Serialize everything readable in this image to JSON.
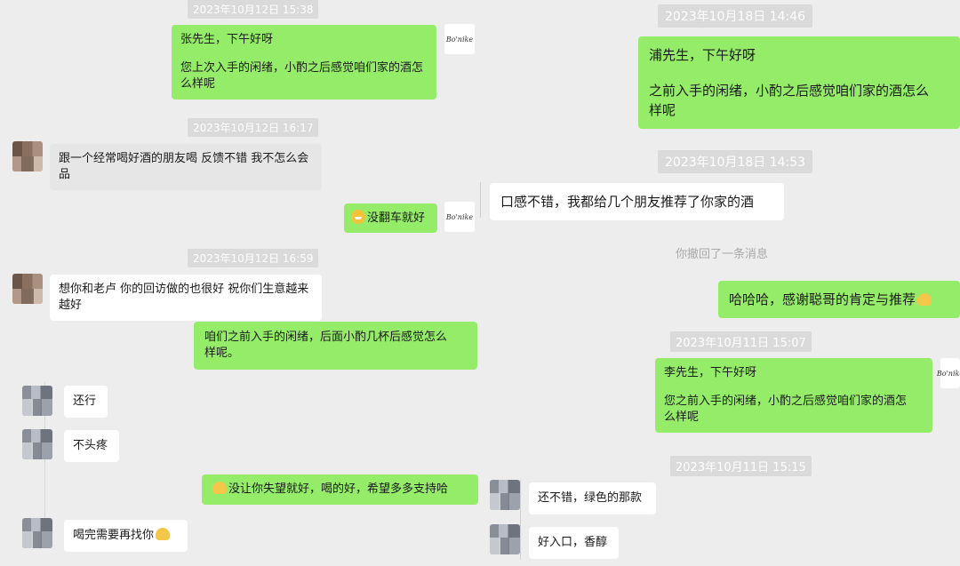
{
  "left": {
    "timestamps": [
      "2023年10月12日 15:38",
      "2023年10月12日 16:17",
      "2023年10月12日 16:59"
    ],
    "messages": [
      {
        "lines": [
          "张先生，下午好呀",
          "",
          "您上次入手的闲绪，小酌之后感觉咱们家的酒怎",
          "么样呢"
        ]
      },
      {
        "lines": [
          "跟一个经常喝好酒的朋友喝 反馈不错 我不怎么会",
          "品"
        ]
      },
      {
        "text": "没翻车就好"
      },
      {
        "lines": [
          "想你和老卢 你的回访做的也很好 祝你们生意越来",
          "越好"
        ]
      },
      {
        "lines": [
          "咱们之前入手的闲绪，后面小酌几杯后感觉怎么",
          "样呢。"
        ]
      },
      {
        "text": "还行"
      },
      {
        "text": "不头疼"
      },
      {
        "text": "没让你失望就好，喝的好，希望多多支持哈"
      },
      {
        "text": "喝完需要再找你"
      }
    ],
    "signature": "Bo'nike"
  },
  "right": {
    "timestamps": [
      "2023年10月18日 14:46",
      "2023年10月18日 14:53",
      "2023年10月11日 15:07",
      "2023年10月11日 15:15"
    ],
    "messages": [
      {
        "lines": [
          "浦先生，下午好呀",
          "",
          "之前入手的闲绪，小酌之后感觉咱们家的酒怎么",
          "样呢"
        ]
      },
      {
        "text": "口感不错，我都给几个朋友推荐了你家的酒"
      },
      {
        "text": "哈哈哈，感谢聪哥的肯定与推荐"
      },
      {
        "lines": [
          "李先生，下午好呀",
          "",
          "您之前入手的闲绪，小酌之后感觉咱们家的酒怎",
          "么样呢"
        ]
      },
      {
        "text": "还不错，绿色的那款"
      },
      {
        "text": "好入口，香醇"
      }
    ],
    "recall_notice": "你撤回了一条消息",
    "signature": "Bo'nike"
  }
}
